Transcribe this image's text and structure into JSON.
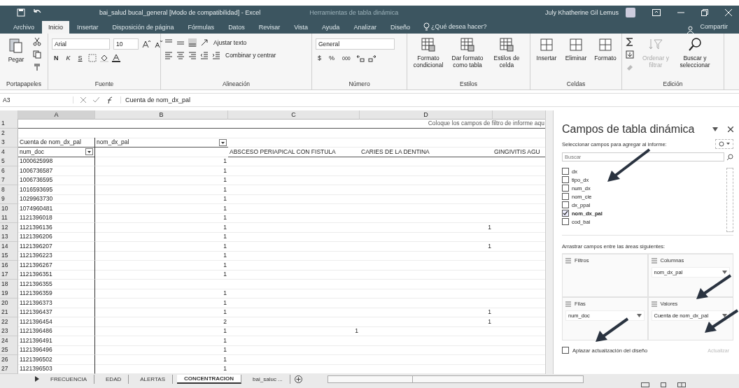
{
  "title_bar": {
    "document_title": "bai_salud bucal_general [Modo de compatibilidad] - Excel",
    "context_title": "Herramientas de tabla dinámica",
    "user": "July Khatherine Gil Lemus"
  },
  "menu_tabs": [
    {
      "label": "Archivo",
      "selected": false
    },
    {
      "label": "Inicio",
      "selected": true
    },
    {
      "label": "Insertar",
      "selected": false
    },
    {
      "label": "Disposición de página",
      "selected": false
    },
    {
      "label": "Fórmulas",
      "selected": false
    },
    {
      "label": "Datos",
      "selected": false
    },
    {
      "label": "Revisar",
      "selected": false
    },
    {
      "label": "Vista",
      "selected": false
    },
    {
      "label": "Ayuda",
      "selected": false
    },
    {
      "label": "Analizar",
      "selected": false
    },
    {
      "label": "Diseño",
      "selected": false
    }
  ],
  "tell_me": "¿Qué desea hacer?",
  "share": "Compartir",
  "ribbon": {
    "clipboard": {
      "label": "Portapapeles",
      "paste": "Pegar"
    },
    "font": {
      "label": "Fuente",
      "family": "Arial",
      "size": "10",
      "bold": "N",
      "italic": "K",
      "underline": "S"
    },
    "alignment": {
      "label": "Alineación",
      "wrap": "Ajustar texto",
      "merge": "Combinar y centrar"
    },
    "number": {
      "label": "Número",
      "format": "General",
      "currency": "$",
      "percent": "%",
      "thousands": "000"
    },
    "styles": {
      "label": "Estilos",
      "buttons": [
        "Formato condicional",
        "Dar formato como tabla",
        "Estilos de celda"
      ]
    },
    "cells": {
      "label": "Celdas",
      "buttons": [
        "Insertar",
        "Eliminar",
        "Formato"
      ]
    },
    "editing": {
      "label": "Edición",
      "tools": [
        {
          "label": "Ordenar y filtrar",
          "disabled": true
        },
        {
          "label": "Buscar y seleccionar",
          "disabled": false
        }
      ]
    }
  },
  "formula_bar": {
    "name_box": "A3",
    "formula": "Cuenta de nom_dx_pal"
  },
  "columns": [
    "A",
    "B",
    "C",
    "D"
  ],
  "rows": [
    {
      "num": "1",
      "hint": "Coloque los campos de filtro de informe aqu"
    },
    {
      "num": "2"
    },
    {
      "num": "3",
      "a": "Cuenta de nom_dx_pal",
      "b": "nom_dx_pal",
      "b_filter": true
    },
    {
      "num": "4",
      "a": "num_doc",
      "c": "ABSCESO PERIAPICAL CON FISTULA",
      "d": "CARIES DE LA DENTINA",
      "e": "GINGIVITIS AGU",
      "a_filter": true
    },
    {
      "num": "5",
      "a": "1000625998",
      "b": "1"
    },
    {
      "num": "6",
      "a": "1006736587",
      "b": "1"
    },
    {
      "num": "7",
      "a": "1006736595",
      "b": "1"
    },
    {
      "num": "8",
      "a": "1016593695",
      "b": "1"
    },
    {
      "num": "9",
      "a": "1029963730",
      "b": "1"
    },
    {
      "num": "10",
      "a": "1074960481",
      "b": "1"
    },
    {
      "num": "11",
      "a": "1121396018",
      "b": "1"
    },
    {
      "num": "12",
      "a": "1121396136",
      "b": "1",
      "d": "1"
    },
    {
      "num": "13",
      "a": "1121396206",
      "b": "1"
    },
    {
      "num": "14",
      "a": "1121396207",
      "b": "1",
      "d": "1"
    },
    {
      "num": "15",
      "a": "1121396223",
      "b": "1"
    },
    {
      "num": "16",
      "a": "1121396267",
      "b": "1"
    },
    {
      "num": "17",
      "a": "1121396351",
      "b": "1"
    },
    {
      "num": "18",
      "a": "1121396355"
    },
    {
      "num": "19",
      "a": "1121396359",
      "b": "1"
    },
    {
      "num": "20",
      "a": "1121396373",
      "b": "1"
    },
    {
      "num": "21",
      "a": "1121396437",
      "b": "1",
      "d": "1"
    },
    {
      "num": "22",
      "a": "1121396454",
      "b": "2",
      "d": "1"
    },
    {
      "num": "23",
      "a": "1121396486",
      "b": "1",
      "c": "1"
    },
    {
      "num": "24",
      "a": "1121396491",
      "b": "1"
    },
    {
      "num": "25",
      "a": "1121396496",
      "b": "1"
    },
    {
      "num": "26",
      "a": "1121396502",
      "b": "1"
    },
    {
      "num": "27",
      "a": "1121396503",
      "b": "1"
    }
  ],
  "sheet_tabs": [
    {
      "label": "FRECUENCIA",
      "selected": false
    },
    {
      "label": "EDAD",
      "selected": false
    },
    {
      "label": "ALERTAS",
      "selected": false
    },
    {
      "label": "CONCENTRACION",
      "selected": true
    },
    {
      "label": "bai_saluc ...",
      "selected": false
    }
  ],
  "pivot_pane": {
    "title": "Campos de tabla dinámica",
    "subtitle": "Seleccionar campos para agregar al informe:",
    "search": {
      "placeholder": "Buscar"
    },
    "fields": [
      {
        "label": "dx",
        "checked": false
      },
      {
        "label": "tipo_dx",
        "checked": false
      },
      {
        "label": "num_dx",
        "checked": false
      },
      {
        "label": "nom_cie",
        "checked": false
      },
      {
        "label": "dx_ppal",
        "checked": false
      },
      {
        "label": "nom_dx_pal",
        "checked": true
      },
      {
        "label": "cod_bai",
        "checked": false
      }
    ],
    "areas_label": "Arrastrar campos entre las áreas siguientes:",
    "areas": [
      {
        "label": "Filtros"
      },
      {
        "label": "Columnas",
        "items": [
          "nom_dx_pal"
        ]
      },
      {
        "label": "Filas",
        "items": [
          "num_doc"
        ]
      },
      {
        "label": "Valores",
        "items": [
          "Cuenta de nom_dx_pal"
        ]
      }
    ],
    "defer": {
      "label": "Aplazar actualización del diseño",
      "checked": false
    },
    "update": {
      "label": "Actualizar",
      "disabled": true
    }
  }
}
